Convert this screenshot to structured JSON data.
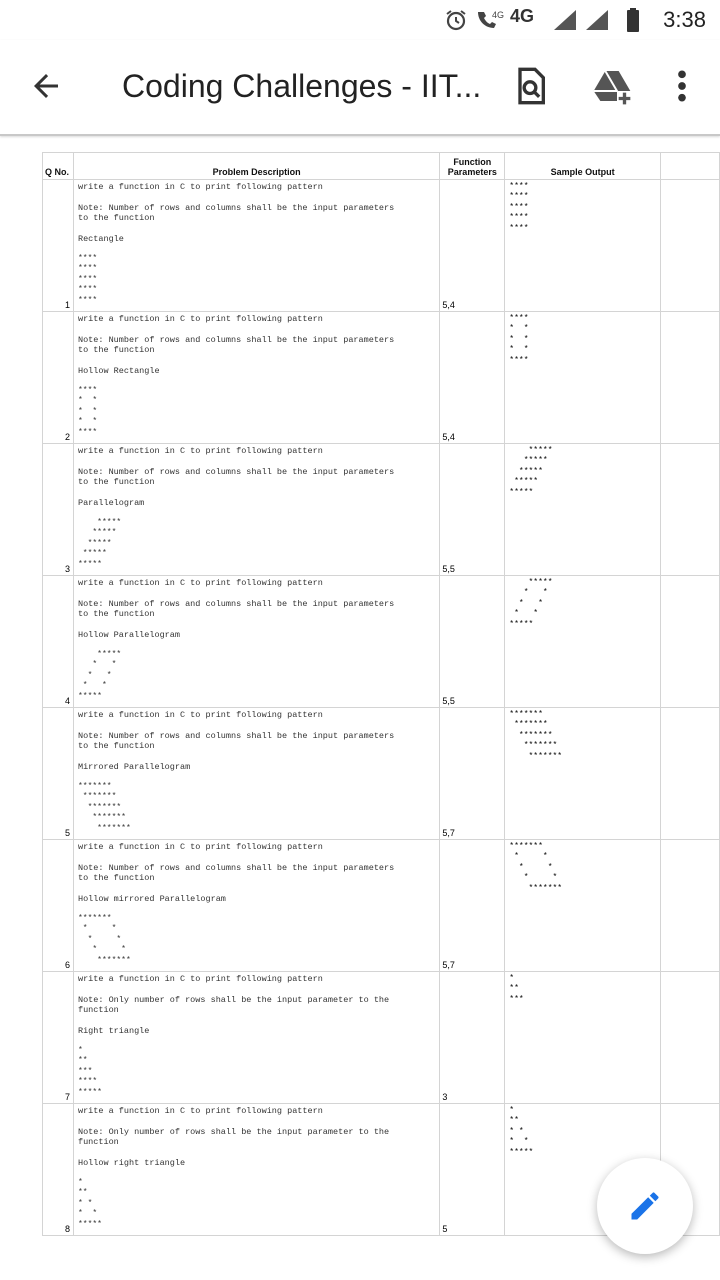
{
  "status_bar": {
    "time": "3:38",
    "network": "4G",
    "icons": [
      "alarm-icon",
      "volte-call-icon",
      "signal-icon",
      "signal-icon",
      "battery-icon"
    ]
  },
  "app_bar": {
    "title": "Coding Challenges - IIT...",
    "icons": [
      "back-arrow-icon",
      "preview-icon",
      "add-to-drive-icon",
      "more-vert-icon"
    ]
  },
  "table": {
    "headers": {
      "qno": "Q No.",
      "desc": "Problem Description",
      "params": "Function\nParameters",
      "output": "Sample Output"
    },
    "rows": [
      {
        "qno": "1",
        "lines": [
          "write a function in C to print following pattern",
          "",
          "Note: Number of rows and columns shall be the input parameters\nto the function",
          "",
          "Rectangle"
        ],
        "pattern": "****\n****\n****\n****\n****",
        "params": "5,4",
        "output": "****\n****\n****\n****\n****"
      },
      {
        "qno": "2",
        "lines": [
          "write a function in C to print following pattern",
          "",
          "Note: Number of rows and columns shall be the input parameters\nto the function",
          "",
          "Hollow Rectangle"
        ],
        "pattern": "****\n*  *\n*  *\n*  *\n****",
        "params": "5,4",
        "output": "****\n*  *\n*  *\n*  *\n****"
      },
      {
        "qno": "3",
        "lines": [
          "write a function in C to print following pattern",
          "",
          "Note: Number of rows and columns shall be the input parameters\nto the function",
          "",
          "Parallelogram"
        ],
        "pattern": "    *****\n   *****\n  *****\n *****\n*****",
        "params": "5,5",
        "output": "    *****\n   *****\n  *****\n *****\n*****"
      },
      {
        "qno": "4",
        "lines": [
          "write a function in C to print following pattern",
          "",
          "Note: Number of rows and columns shall be the input parameters\nto the function",
          "",
          "Hollow Parallelogram"
        ],
        "pattern": "    *****\n   *   *\n  *   *\n *   *\n*****",
        "params": "5,5",
        "output": "    *****\n   *   *\n  *   *\n *   *\n*****"
      },
      {
        "qno": "5",
        "lines": [
          "write a function in C to print following pattern",
          "",
          "Note: Number of rows and columns shall be the input parameters\nto the function",
          "",
          "Mirrored Parallelogram"
        ],
        "pattern": "*******\n *******\n  *******\n   *******\n    *******",
        "params": "5,7",
        "output": "*******\n *******\n  *******\n   *******\n    *******"
      },
      {
        "qno": "6",
        "lines": [
          "write a function in C to print following pattern",
          "",
          "Note: Number of rows and columns shall be the input parameters\nto the function",
          "",
          "Hollow mirrored Parallelogram"
        ],
        "pattern": "*******\n *     *\n  *     *\n   *     *\n    *******",
        "params": "5,7",
        "output": "*******\n *     *\n  *     *\n   *     *\n    *******"
      },
      {
        "qno": "7",
        "lines": [
          "write a function in C to print following pattern",
          "",
          "Note: Only number of rows shall be the input parameter to the\nfunction",
          "",
          "Right triangle"
        ],
        "pattern": "*\n**\n***\n****\n*****",
        "params": "3",
        "output": "*\n**\n***"
      },
      {
        "qno": "8",
        "lines": [
          "write a function in C to print following pattern",
          "",
          "Note: Only number of rows shall be the input parameter to the\nfunction",
          "",
          "Hollow right triangle"
        ],
        "pattern": "*\n**\n* *\n*  *\n*****",
        "params": "5",
        "output": "*\n**\n* *\n*  *\n*****"
      }
    ]
  },
  "fab": {
    "icon": "edit-pencil-icon",
    "color": "#1a73e8"
  }
}
